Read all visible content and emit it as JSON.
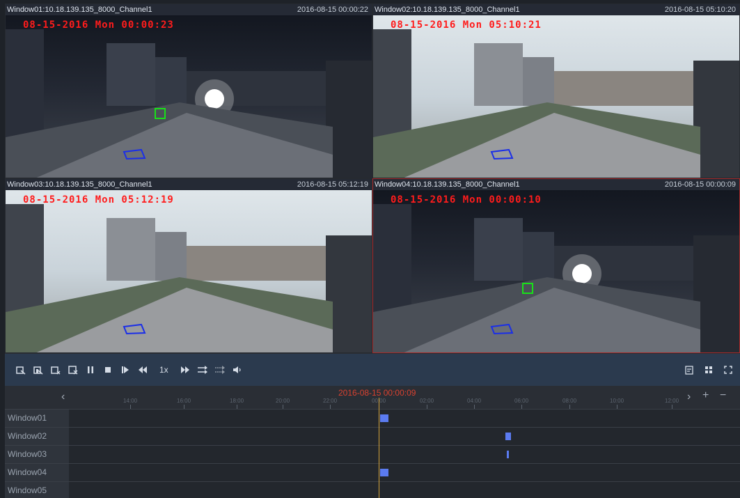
{
  "windows": [
    {
      "title": "Window01:10.18.139.135_8000_Channel1",
      "timestamp": "2016-08-15 00:00:22",
      "osd": "08-15-2016 Mon 00:00:23",
      "scene": "night"
    },
    {
      "title": "Window02:10.18.139.135_8000_Channel1",
      "timestamp": "2016-08-15 05:10:20",
      "osd": "08-15-2016 Mon 05:10:21",
      "scene": "day"
    },
    {
      "title": "Window03:10.18.139.135_8000_Channel1",
      "timestamp": "2016-08-15 05:12:19",
      "osd": "08-15-2016 Mon 05:12:19",
      "scene": "day"
    },
    {
      "title": "Window04:10.18.139.135_8000_Channel1",
      "timestamp": "2016-08-15 00:00:09",
      "osd": "08-15-2016 Mon 00:00:10",
      "scene": "night"
    }
  ],
  "controls": {
    "speed": "1x",
    "icons": [
      "capture-icon",
      "capture-all-icon",
      "clip-icon",
      "clip-all-icon",
      "pause-icon",
      "stop-icon",
      "step-forward-icon",
      "rewind-icon",
      "fast-forward-icon",
      "sync-icon",
      "async-icon",
      "volume-icon"
    ],
    "right_icons": [
      "file-icon",
      "grid-layout-icon",
      "fullscreen-icon"
    ]
  },
  "timeline": {
    "current_time": "2016-08-15 00:00:09",
    "ticks": [
      "14:00",
      "16:00",
      "18:00",
      "20:00",
      "22:00",
      "00:00",
      "02:00",
      "04:00",
      "06:00",
      "08:00",
      "10:00",
      "12:00"
    ],
    "rows": [
      {
        "label": "Window01"
      },
      {
        "label": "Window02"
      },
      {
        "label": "Window03"
      },
      {
        "label": "Window04"
      },
      {
        "label": "Window05"
      }
    ],
    "colors": {
      "segment": "#5b7bf0",
      "cursor": "#d6a43a",
      "current_time_text": "#d9412f"
    }
  }
}
